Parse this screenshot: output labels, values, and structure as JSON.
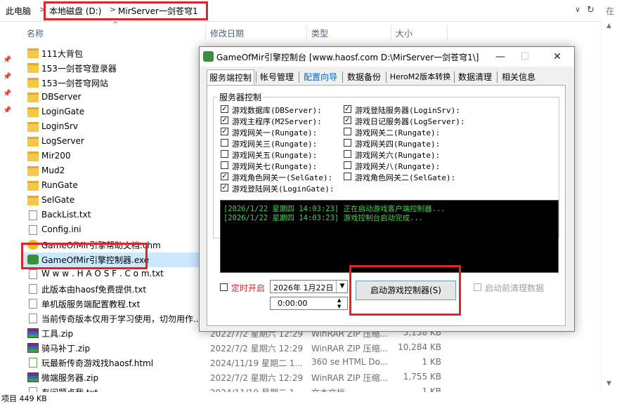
{
  "address": {
    "crumbs": [
      "此电脑",
      "本地磁盘 (D:)",
      "MirServer一剑苍穹1"
    ],
    "sep": ">",
    "dropdown": "∨",
    "refresh": "↻",
    "search_partial": "在"
  },
  "columns": {
    "name": "名称",
    "date": "修改日期",
    "type": "类型",
    "size": "大小"
  },
  "files": [
    {
      "name": "111大背包",
      "kind": "folder",
      "date": "",
      "type": "",
      "size": ""
    },
    {
      "name": "153一剑苍穹登录器",
      "kind": "folder",
      "date": "",
      "type": "",
      "size": ""
    },
    {
      "name": "153一剑苍穹网站",
      "kind": "folder",
      "date": "",
      "type": "",
      "size": ""
    },
    {
      "name": "DBServer",
      "kind": "folder",
      "date": "",
      "type": "",
      "size": ""
    },
    {
      "name": "LoginGate",
      "kind": "folder",
      "date": "",
      "type": "",
      "size": ""
    },
    {
      "name": "LoginSrv",
      "kind": "folder",
      "date": "",
      "type": "",
      "size": ""
    },
    {
      "name": "LogServer",
      "kind": "folder",
      "date": "",
      "type": "",
      "size": ""
    },
    {
      "name": "Mir200",
      "kind": "folder",
      "date": "",
      "type": "",
      "size": ""
    },
    {
      "name": "Mud2",
      "kind": "folder",
      "date": "",
      "type": "",
      "size": ""
    },
    {
      "name": "RunGate",
      "kind": "folder",
      "date": "",
      "type": "",
      "size": ""
    },
    {
      "name": "SelGate",
      "kind": "folder",
      "date": "",
      "type": "",
      "size": ""
    },
    {
      "name": "BackList.txt",
      "kind": "doc",
      "date": "",
      "type": "",
      "size": ""
    },
    {
      "name": "Config.ini",
      "kind": "doc",
      "date": "",
      "type": "",
      "size": ""
    },
    {
      "name": "GameOfMir引擎帮助文档.chm",
      "kind": "chm",
      "date": "",
      "type": "",
      "size": ""
    },
    {
      "name": "GameOfMir引擎控制器.exe",
      "kind": "exe",
      "date": "",
      "type": "",
      "size": ""
    },
    {
      "name": "W w w . H A O S F . C o m.txt",
      "kind": "doc",
      "date": "",
      "type": "",
      "size": ""
    },
    {
      "name": "此版本由haosf免费提供.txt",
      "kind": "doc",
      "date": "",
      "type": "",
      "size": ""
    },
    {
      "name": "单机版服务端配置教程.txt",
      "kind": "doc",
      "date": "",
      "type": "",
      "size": ""
    },
    {
      "name": "当前传奇版本仅用于学习使用，切勿用作...",
      "kind": "doc",
      "date": "",
      "type": "",
      "size": ""
    },
    {
      "name": "工具.zip",
      "kind": "zip",
      "date": "2022/7/2 星期六 12:29",
      "type": "WinRAR ZIP 压缩...",
      "size": "5,158 KB"
    },
    {
      "name": "骑马补丁.zip",
      "kind": "zip",
      "date": "2022/7/2 星期六 12:29",
      "type": "WinRAR ZIP 压缩...",
      "size": "10,284 KB"
    },
    {
      "name": "玩最新传奇游戏找haosf.html",
      "kind": "html",
      "date": "2024/11/19 星期二 1...",
      "type": "360 se HTML Do...",
      "size": "1 KB"
    },
    {
      "name": "微端服务器.zip",
      "kind": "zip",
      "date": "2022/7/2 星期六 12:29",
      "type": "WinRAR ZIP 压缩...",
      "size": "1,755 KB"
    },
    {
      "name": "有问题点我.txt",
      "kind": "doc",
      "date": "2024/11/19 星期二 1...",
      "type": "文本文档",
      "size": "1 KB"
    }
  ],
  "status": {
    "text": "项目  449 KB"
  },
  "dialog": {
    "title": "GameOfMir引擎控制台 [www.haosf.com D:\\MirServer一剑苍穹1\\]",
    "minimize": "—",
    "maximize": "☐",
    "close": "✕",
    "tabs": [
      "服务端控制",
      "帐号管理",
      "配置向导",
      "数据备份",
      "HeroM2版本转换",
      "数据清理",
      "相关信息"
    ],
    "group_label": "服务器控制",
    "servers_left": [
      {
        "label": "游戏数据库(DBServer):",
        "checked": true
      },
      {
        "label": "游戏主程序(M2Server):",
        "checked": true
      },
      {
        "label": "游戏网关一(Rungate):",
        "checked": true
      },
      {
        "label": "游戏网关三(Rungate):",
        "checked": false
      },
      {
        "label": "游戏网关五(Rungate):",
        "checked": false
      },
      {
        "label": "游戏网关七(Rungate):",
        "checked": false
      },
      {
        "label": "游戏角色网关一(SelGate):",
        "checked": true
      },
      {
        "label": "游戏登陆网关(LoginGate):",
        "checked": true
      }
    ],
    "servers_right": [
      {
        "label": "游戏登陆服务器(LoginSrv):",
        "checked": true
      },
      {
        "label": "游戏日记服务器(LogServer):",
        "checked": true
      },
      {
        "label": "游戏网关二(Rungate):",
        "checked": false
      },
      {
        "label": "游戏网关四(Rungate):",
        "checked": false
      },
      {
        "label": "游戏网关六(Rungate):",
        "checked": false
      },
      {
        "label": "游戏网关八(Rungate):",
        "checked": false
      },
      {
        "label": "游戏角色网关二(SelGate):",
        "checked": false
      }
    ],
    "log": [
      "[2026/1/22 星期四 14:03:23] 正在启动游戏客户端控制器...",
      "[2026/1/22 星期四 14:03:23] 游戏控制台启动完成..."
    ],
    "timer_label": "定时开启",
    "date_value": "2026年 1月22日",
    "time_value": "0:00:00",
    "start_button": "启动游戏控制器(S)",
    "clean_label": "启动前清理数据"
  },
  "colors": {
    "highlight": "#e0242b",
    "log_text": "#3fd34a",
    "link_tab": "#0066cc",
    "selected_row": "#cce8ff"
  }
}
